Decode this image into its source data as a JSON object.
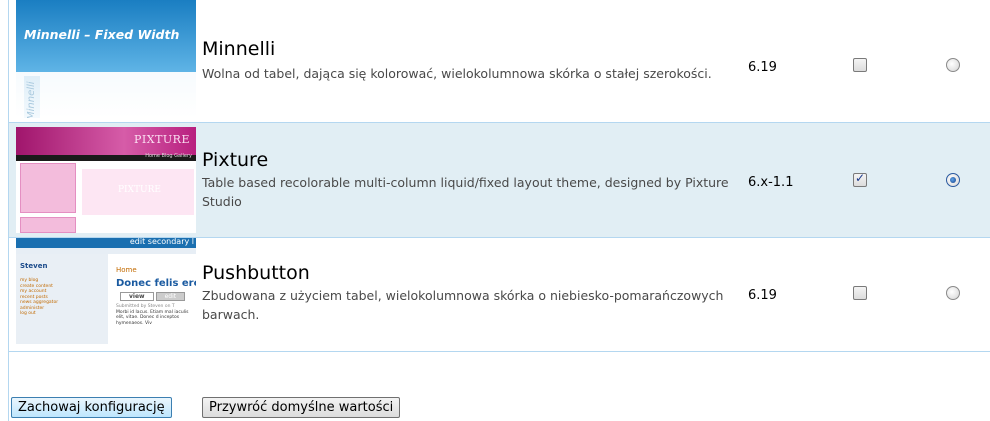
{
  "themes": [
    {
      "name": "Minnelli",
      "description": "Wolna od tabel, dająca się kolorować, wielokolumnowa skórka o stałej szerokości.",
      "version": "6.19",
      "enabled": false,
      "default": false,
      "screenshot": {
        "title": "Minnelli – Fixed Width",
        "side_text": "Minnelli"
      }
    },
    {
      "name": "Pixture",
      "description": "Table based recolorable multi-column liquid/fixed layout theme, designed by Pixture Studio",
      "version": "6.x-1.1",
      "enabled": true,
      "default": true,
      "screenshot": {
        "header": "PIXTURE",
        "nav": "Home Blog Gallery",
        "watermark": "PIXTURE"
      }
    },
    {
      "name": "Pushbutton",
      "description": "Zbudowana z użyciem tabel, wielokolumnowa skórka o niebiesko-pomarańczowych barwach.",
      "version": "6.19",
      "enabled": false,
      "default": false,
      "screenshot": {
        "secondary": "edit secondary l",
        "user": "Steven",
        "menu": [
          "my blog",
          "create content",
          "my account",
          "recent posts",
          "news aggregator",
          "administer",
          "log out"
        ],
        "breadcrumb": "Home",
        "node_title": "Donec felis erc",
        "tabs": [
          "view",
          "edit"
        ],
        "submitted": "Submitted by Steven on T",
        "body": "Morbi id lacus. Etiam mal iaculis elit, vitae. Donec d inceptos hymenaeos. Viv"
      }
    }
  ],
  "buttons": {
    "save": "Zachowaj konfigurację",
    "reset": "Przywróć domyślne wartości"
  },
  "colors": {
    "border": "#b4d7f0",
    "selected_row": "#e1eef4"
  }
}
